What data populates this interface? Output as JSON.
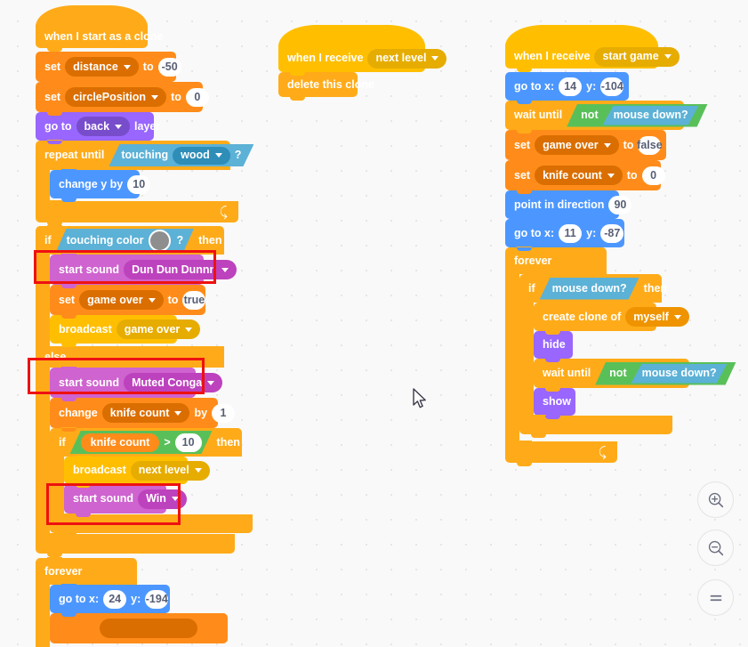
{
  "app": {
    "name": "Scratch Block Editor Canvas",
    "background_color": "#f9f9f9",
    "highlight_color": "#ee1111"
  },
  "scripts": [
    {
      "id": "clone-script",
      "hat": {
        "label": "when I start as a clone"
      },
      "blocks": [
        {
          "type": "set-variable",
          "label": "set",
          "variable": "distance",
          "to_label": "to",
          "value": "-50"
        },
        {
          "type": "set-variable",
          "label": "set",
          "variable": "circlePosition",
          "to_label": "to",
          "value": "0"
        },
        {
          "type": "go-to-layer",
          "label": "go to",
          "layer": "back",
          "suffix": "layer"
        },
        {
          "type": "repeat-until",
          "label": "repeat until",
          "condition": {
            "label": "touching",
            "object": "wood",
            "suffix": "?"
          },
          "body": [
            {
              "type": "change-y",
              "label": "change y by",
              "value": "10"
            }
          ]
        },
        {
          "type": "if-else",
          "if_label": "if",
          "then_label": "then",
          "else_label": "else",
          "condition": {
            "label": "touching color",
            "suffix": "?",
            "color": "#8e8e8e"
          },
          "then_body": [
            {
              "type": "start-sound",
              "label": "start sound",
              "sound": "Dun Dun Dunnn",
              "highlighted": true
            },
            {
              "type": "set-variable",
              "label": "set",
              "variable": "game over",
              "to_label": "to",
              "value": "true"
            },
            {
              "type": "broadcast",
              "label": "broadcast",
              "message": "game over"
            }
          ],
          "else_body": [
            {
              "type": "start-sound",
              "label": "start sound",
              "sound": "Muted Conga",
              "highlighted": true
            },
            {
              "type": "change-variable",
              "label": "change",
              "variable": "knife count",
              "by_label": "by",
              "value": "1"
            },
            {
              "type": "if-then",
              "if_label": "if",
              "then_label": "then",
              "condition": {
                "left": "knife count",
                "operator": ">",
                "right": "10"
              },
              "body": [
                {
                  "type": "broadcast",
                  "label": "broadcast",
                  "message": "next level"
                },
                {
                  "type": "start-sound",
                  "label": "start sound",
                  "sound": "Win",
                  "highlighted": true
                }
              ]
            }
          ]
        },
        {
          "type": "forever",
          "label": "forever",
          "body": [
            {
              "type": "go-to-xy",
              "label": "go to x:",
              "x": "24",
              "y_label": "y:",
              "y": "-194"
            },
            {
              "type": "change-variable-clipped",
              "label": "change",
              "variable": "",
              "by_label": "by",
              "value": ""
            }
          ]
        }
      ]
    },
    {
      "id": "next-level-script",
      "hat": {
        "label": "when I receive",
        "message": "next level"
      },
      "blocks": [
        {
          "type": "delete-clone",
          "label": "delete this clone"
        }
      ]
    },
    {
      "id": "start-game-script",
      "hat": {
        "label": "when I receive",
        "message": "start game"
      },
      "blocks": [
        {
          "type": "go-to-xy",
          "label": "go to x:",
          "x": "14",
          "y_label": "y:",
          "y": "-104"
        },
        {
          "type": "wait-until",
          "label": "wait until",
          "not_label": "not",
          "condition": "mouse down?"
        },
        {
          "type": "set-variable",
          "label": "set",
          "variable": "game over",
          "to_label": "to",
          "value": "false"
        },
        {
          "type": "set-variable",
          "label": "set",
          "variable": "knife count",
          "to_label": "to",
          "value": "0"
        },
        {
          "type": "point-in-direction",
          "label": "point in direction",
          "value": "90"
        },
        {
          "type": "go-to-xy",
          "label": "go to x:",
          "x": "11",
          "y_label": "y:",
          "y": "-87"
        },
        {
          "type": "forever",
          "label": "forever",
          "body": [
            {
              "type": "if-then",
              "if_label": "if",
              "then_label": "then",
              "condition": "mouse down?",
              "body": [
                {
                  "type": "create-clone",
                  "label": "create clone of",
                  "target": "myself"
                },
                {
                  "type": "hide",
                  "label": "hide"
                },
                {
                  "type": "wait-until",
                  "label": "wait until",
                  "not_label": "not",
                  "condition": "mouse down?"
                },
                {
                  "type": "show",
                  "label": "show"
                }
              ]
            }
          ]
        }
      ]
    }
  ],
  "zoom_controls": [
    {
      "name": "zoom-in",
      "glyph": "+"
    },
    {
      "name": "zoom-out",
      "glyph": "−"
    },
    {
      "name": "zoom-reset",
      "glyph": "="
    }
  ]
}
